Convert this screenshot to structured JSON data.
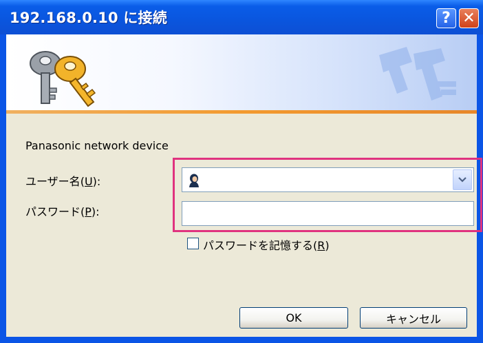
{
  "window": {
    "title": "192.168.0.10 に接続",
    "help_symbol": "?",
    "close_symbol": "✕"
  },
  "dialog": {
    "realm": "Panasonic network device",
    "username_label": "ユーザー名",
    "username_mnemonic": "U",
    "username_value": "",
    "password_label": "パスワード",
    "password_mnemonic": "P",
    "password_value": "",
    "remember_label": "パスワードを記憶する",
    "remember_mnemonic": "R",
    "remember_checked": false,
    "ok_label": "OK",
    "cancel_label": "キャンセル"
  },
  "colors": {
    "titlebar": "#0a56df",
    "highlight": "#e0327f",
    "dialog_bg": "#ece9d8"
  },
  "icons": {
    "banner": "keys-icon",
    "username_field": "user-icon",
    "dropdown": "chevron-down-icon"
  }
}
